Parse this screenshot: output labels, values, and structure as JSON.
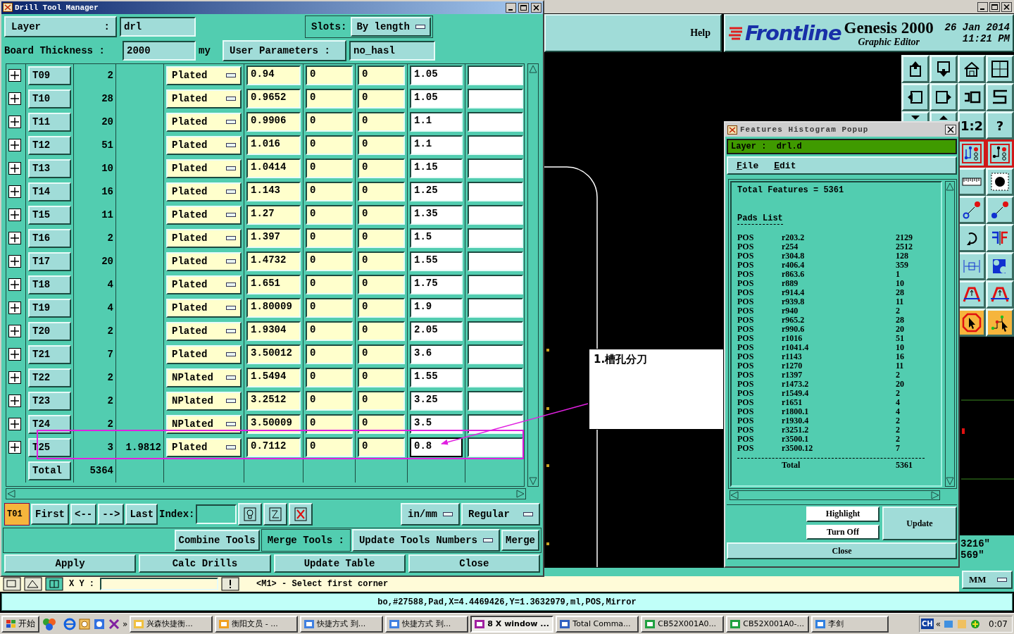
{
  "app": {
    "help": "Help",
    "logo": "Frontline",
    "product": "Genesis 2000",
    "subtitle": "Graphic Editor",
    "date": "26 Jan 2014",
    "time": "11:21 PM",
    "toolbar_labels": [
      "1:2",
      "?"
    ],
    "coords": [
      "3216\"",
      "569\""
    ],
    "units": "MM",
    "xy_label": "X Y :",
    "prompt": "<M1> - Select first corner",
    "status": "bo,#27588,Pad,X=4.4469426,Y=1.3632979,ml,POS,Mirror"
  },
  "drill_window": {
    "title": "Drill Tool Manager",
    "layer_label": "Layer",
    "layer_colon": ":",
    "layer_value": "drl",
    "slots_label": "Slots:",
    "slots_value": "By length",
    "thickness_label": "Board Thickness :",
    "thickness_value": "2000",
    "thickness_unit": "my",
    "user_params_label": "User Parameters :",
    "user_params_value": "no_hasl",
    "rows": [
      {
        "tool": "T09",
        "count": "2",
        "type": "Plated",
        "finish": "0.94",
        "col_7": "0",
        "col_8": "0",
        "drill": "1.05",
        "drill_focused": false
      },
      {
        "tool": "T10",
        "count": "28",
        "type": "Plated",
        "finish": "0.9652",
        "col_7": "0",
        "col_8": "0",
        "drill": "1.05",
        "drill_focused": false
      },
      {
        "tool": "T11",
        "count": "20",
        "type": "Plated",
        "finish": "0.9906",
        "col_7": "0",
        "col_8": "0",
        "drill": "1.1",
        "drill_focused": false
      },
      {
        "tool": "T12",
        "count": "51",
        "type": "Plated",
        "finish": "1.016",
        "col_7": "0",
        "col_8": "0",
        "drill": "1.1",
        "drill_focused": false
      },
      {
        "tool": "T13",
        "count": "10",
        "type": "Plated",
        "finish": "1.0414",
        "col_7": "0",
        "col_8": "0",
        "drill": "1.15",
        "drill_focused": false
      },
      {
        "tool": "T14",
        "count": "16",
        "type": "Plated",
        "finish": "1.143",
        "col_7": "0",
        "col_8": "0",
        "drill": "1.25",
        "drill_focused": false
      },
      {
        "tool": "T15",
        "count": "11",
        "type": "Plated",
        "finish": "1.27",
        "col_7": "0",
        "col_8": "0",
        "drill": "1.35",
        "drill_focused": false
      },
      {
        "tool": "T16",
        "count": "2",
        "type": "Plated",
        "finish": "1.397",
        "col_7": "0",
        "col_8": "0",
        "drill": "1.5",
        "drill_focused": false
      },
      {
        "tool": "T17",
        "count": "20",
        "type": "Plated",
        "finish": "1.4732",
        "col_7": "0",
        "col_8": "0",
        "drill": "1.55",
        "drill_focused": false
      },
      {
        "tool": "T18",
        "count": "4",
        "type": "Plated",
        "finish": "1.651",
        "col_7": "0",
        "col_8": "0",
        "drill": "1.75",
        "drill_focused": false
      },
      {
        "tool": "T19",
        "count": "4",
        "type": "Plated",
        "finish": "1.80009",
        "col_7": "0",
        "col_8": "0",
        "drill": "1.9",
        "drill_focused": false
      },
      {
        "tool": "T20",
        "count": "2",
        "type": "Plated",
        "finish": "1.9304",
        "col_7": "0",
        "col_8": "0",
        "drill": "2.05",
        "drill_focused": false
      },
      {
        "tool": "T21",
        "count": "7",
        "type": "Plated",
        "finish": "3.50012",
        "col_7": "0",
        "col_8": "0",
        "drill": "3.6",
        "drill_focused": false
      },
      {
        "tool": "T22",
        "count": "2",
        "type": "NPlated",
        "finish": "1.5494",
        "col_7": "0",
        "col_8": "0",
        "drill": "1.55",
        "drill_focused": false
      },
      {
        "tool": "T23",
        "count": "2",
        "type": "NPlated",
        "finish": "3.2512",
        "col_7": "0",
        "col_8": "0",
        "drill": "3.25",
        "drill_focused": false
      },
      {
        "tool": "T24",
        "count": "2",
        "type": "NPlated",
        "finish": "3.50009",
        "col_7": "0",
        "col_8": "0",
        "drill": "3.5",
        "drill_focused": false
      },
      {
        "tool": "T25",
        "count": "3",
        "slot_length": "1.9812",
        "type": "Plated",
        "finish": "0.7112",
        "col_7": "0",
        "col_8": "0",
        "drill": "0.8",
        "drill_focused": true
      }
    ],
    "total_label": "Total",
    "total_count": "5364",
    "current_tool": "T01",
    "nav_buttons": [
      "First",
      "<--",
      "-->",
      "Last"
    ],
    "index_label": "Index:",
    "units": "in/mm",
    "mode": "Regular",
    "combine": "Combine Tools",
    "merge_label": "Merge Tools :",
    "merge_mode": "Update Tools Numbers",
    "merge": "Merge",
    "actions": [
      "Apply",
      "Calc Drills",
      "Update Table",
      "Close"
    ]
  },
  "annotation": {
    "text": "1.槽孔分刀"
  },
  "histogram": {
    "title": "Features Histogram Popup",
    "layer": "Layer :  drl.d",
    "menu": [
      "File",
      "Edit"
    ],
    "total_line": "Total Features = 5361",
    "section": "Pads List",
    "pads": [
      {
        "polarity": "POS",
        "symbol": "r203.2",
        "count": "2129"
      },
      {
        "polarity": "POS",
        "symbol": "r254",
        "count": "2512"
      },
      {
        "polarity": "POS",
        "symbol": "r304.8",
        "count": "128"
      },
      {
        "polarity": "POS",
        "symbol": "r406.4",
        "count": "359"
      },
      {
        "polarity": "POS",
        "symbol": "r863.6",
        "count": "1"
      },
      {
        "polarity": "POS",
        "symbol": "r889",
        "count": "10"
      },
      {
        "polarity": "POS",
        "symbol": "r914.4",
        "count": "28"
      },
      {
        "polarity": "POS",
        "symbol": "r939.8",
        "count": "11"
      },
      {
        "polarity": "POS",
        "symbol": "r940",
        "count": "2"
      },
      {
        "polarity": "POS",
        "symbol": "r965.2",
        "count": "28"
      },
      {
        "polarity": "POS",
        "symbol": "r990.6",
        "count": "20"
      },
      {
        "polarity": "POS",
        "symbol": "r1016",
        "count": "51"
      },
      {
        "polarity": "POS",
        "symbol": "r1041.4",
        "count": "10"
      },
      {
        "polarity": "POS",
        "symbol": "r1143",
        "count": "16"
      },
      {
        "polarity": "POS",
        "symbol": "r1270",
        "count": "11"
      },
      {
        "polarity": "POS",
        "symbol": "r1397",
        "count": "2"
      },
      {
        "polarity": "POS",
        "symbol": "r1473.2",
        "count": "20"
      },
      {
        "polarity": "POS",
        "symbol": "r1549.4",
        "count": "2"
      },
      {
        "polarity": "POS",
        "symbol": "r1651",
        "count": "4"
      },
      {
        "polarity": "POS",
        "symbol": "r1800.1",
        "count": "4"
      },
      {
        "polarity": "POS",
        "symbol": "r1930.4",
        "count": "2"
      },
      {
        "polarity": "POS",
        "symbol": "r3251.2",
        "count": "2"
      },
      {
        "polarity": "POS",
        "symbol": "r3500.1",
        "count": "2"
      },
      {
        "polarity": "POS",
        "symbol": "r3500.12",
        "count": "7"
      }
    ],
    "total_label": "Total",
    "total_value": "5361",
    "buttons": [
      "Highlight",
      "Turn Off",
      "Update",
      "Close"
    ]
  },
  "taskbar": {
    "start": "开始",
    "more": "»",
    "tasks": [
      {
        "label": "兴森快捷衡...",
        "selected": false
      },
      {
        "label": "衡阳文员 - ...",
        "selected": false
      },
      {
        "label": "快捷方式 到...",
        "selected": false
      },
      {
        "label": "快捷方式 到...",
        "selected": false
      },
      {
        "label": "8 X window ...",
        "selected": true
      },
      {
        "label": "Total Comma...",
        "selected": false
      },
      {
        "label": "CB52X001A0...",
        "selected": false
      },
      {
        "label": "CB52X001A0-...",
        "selected": false
      },
      {
        "label": "李剑",
        "selected": false
      }
    ],
    "lang": "CH",
    "tray_arrow": "«",
    "clock": "0:07"
  }
}
